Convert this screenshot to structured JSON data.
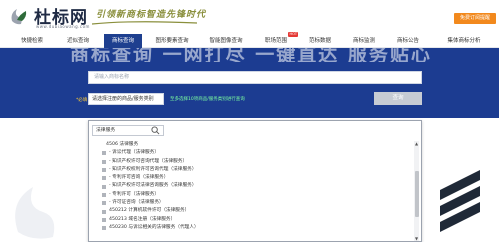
{
  "header": {
    "logo_text": "杜标网",
    "logo_url": "www.dubiaowang.com",
    "slogan": "引领新商标智造先锋时代",
    "top_button": "免费订阅提醒"
  },
  "nav": {
    "items": [
      {
        "label": "快捷检索"
      },
      {
        "label": "近似查询"
      },
      {
        "label": "商标查询"
      },
      {
        "label": "图形要素查询"
      },
      {
        "label": "智能图像查询"
      },
      {
        "label": "职场范围"
      },
      {
        "label": "范标数据"
      },
      {
        "label": "商标监测"
      },
      {
        "label": "商标公告"
      },
      {
        "label": "集体商标分析"
      }
    ],
    "active_index": 2,
    "hot_badge": "HOT"
  },
  "banner": {
    "title": "商标查询 一网打尽 一键直达 服务贴心"
  },
  "search": {
    "placeholder": "请输入商标名称",
    "required_label": "*必填",
    "select_label": "请选择注册的商品/服务类别",
    "select_hint": "至多选择10项商品/服务类别进行查询",
    "query_button": "查询"
  },
  "dropdown": {
    "search_value": "法律服务",
    "items": [
      {
        "text": "4506 法律服务",
        "checkbox": false,
        "indent": 0
      },
      {
        "text": "- 诉讼代理（法律服务）",
        "checkbox": true,
        "indent": 1
      },
      {
        "text": "- 知识产权许可咨询代理（法律服务）",
        "checkbox": true,
        "indent": 1
      },
      {
        "text": "- 知识产权权利许可咨询代理（法律服务）",
        "checkbox": true,
        "indent": 1
      },
      {
        "text": "- 专利许可咨询（法律服务）",
        "checkbox": true,
        "indent": 1
      },
      {
        "text": "- 知识产权许可法律咨询服务（法律服务）",
        "checkbox": true,
        "indent": 1
      },
      {
        "text": "- 专利许可（法律服务）",
        "checkbox": true,
        "indent": 1
      },
      {
        "text": "- 许可证咨询（法律服务）",
        "checkbox": true,
        "indent": 1
      },
      {
        "text": "450212 计算机软件许可（法律服务）",
        "checkbox": true,
        "indent": 1
      },
      {
        "text": "450213 域名注册（法律服务）",
        "checkbox": true,
        "indent": 1
      },
      {
        "text": "450230 与诉讼相关的法律服务（代理人）",
        "checkbox": true,
        "indent": 1
      }
    ]
  },
  "colors": {
    "brand_blue": "#1c3c91",
    "nav_active": "#1e3f8f",
    "accent_orange": "#f2891d",
    "hint_green": "#7cffa0",
    "required_yellow": "#ffcc33"
  }
}
